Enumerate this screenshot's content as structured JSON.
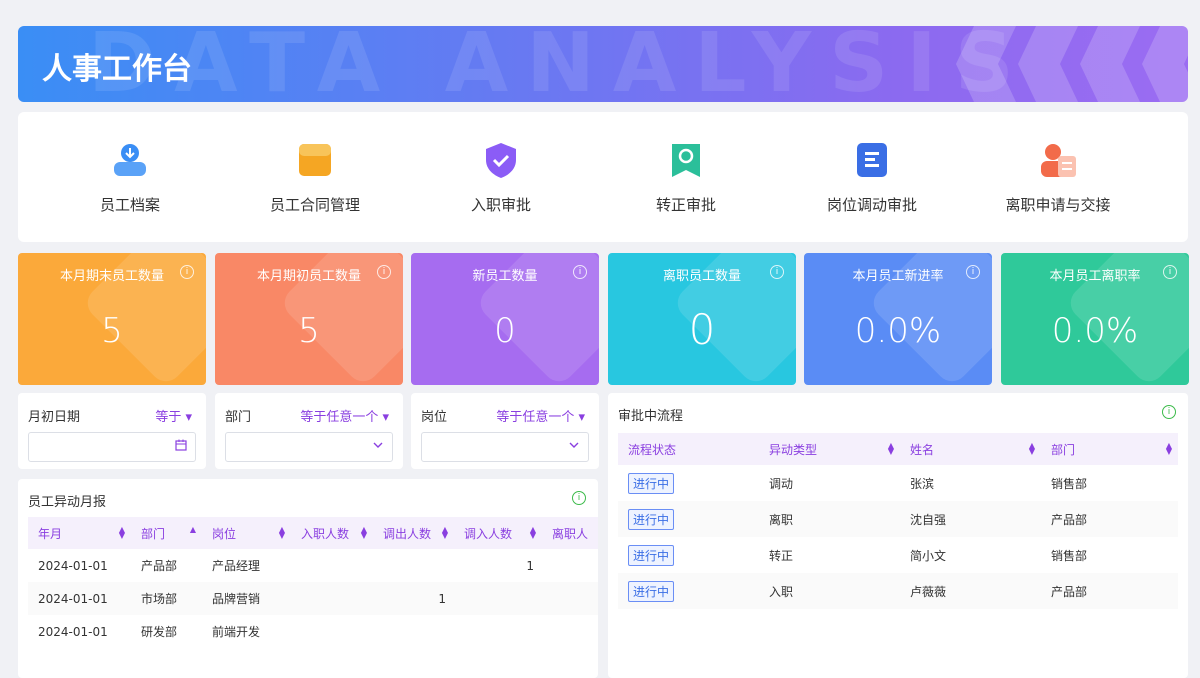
{
  "banner": {
    "title": "人事工作台",
    "bg_text": "DATA ANALYSIS"
  },
  "quick_actions": [
    {
      "label": "员工档案",
      "icon": "employee-file-icon",
      "color": "#3a8ef5"
    },
    {
      "label": "员工合同管理",
      "icon": "contract-icon",
      "color": "#f5a623"
    },
    {
      "label": "入职审批",
      "icon": "onboarding-shield-icon",
      "color": "#8b5cf6"
    },
    {
      "label": "转正审批",
      "icon": "regularization-icon",
      "color": "#2bbf9a"
    },
    {
      "label": "岗位调动审批",
      "icon": "transfer-doc-icon",
      "color": "#3a6ee5"
    },
    {
      "label": "离职申请与交接",
      "icon": "resignation-icon",
      "color": "#f26b4a"
    }
  ],
  "stats": [
    {
      "label": "本月期末员工数量",
      "value": "5",
      "color": "#fba93a"
    },
    {
      "label": "本月期初员工数量",
      "value": "5",
      "color": "#f98866"
    },
    {
      "label": "新员工数量",
      "value": "0",
      "color": "#a66cf0"
    },
    {
      "label": "离职员工数量",
      "value": "0",
      "color": "#28c7e0"
    },
    {
      "label": "本月员工新进率",
      "value": "0.0%",
      "color": "#5a8cf5"
    },
    {
      "label": "本月员工离职率",
      "value": "0.0%",
      "color": "#2fc99a"
    }
  ],
  "info_glyph": "i",
  "filters": [
    {
      "label": "月初日期",
      "op": "等于 ▾",
      "icon": "calendar-icon"
    },
    {
      "label": "部门",
      "op": "等于任意一个 ▾",
      "icon": "chevron-down-icon"
    },
    {
      "label": "岗位",
      "op": "等于任意一个 ▾",
      "icon": "chevron-down-icon"
    }
  ],
  "monthly_report": {
    "title": "员工异动月报",
    "columns": [
      "年月",
      "部门",
      "岗位",
      "入职人数",
      "调出人数",
      "调入人数",
      "离职人"
    ],
    "rows": [
      [
        "2024-01-01",
        "产品部",
        "产品经理",
        "",
        "",
        "1",
        ""
      ],
      [
        "2024-01-01",
        "市场部",
        "品牌营销",
        "",
        "1",
        "",
        ""
      ],
      [
        "2024-01-01",
        "研发部",
        "前端开发",
        "",
        "",
        "",
        ""
      ]
    ]
  },
  "approval_flow": {
    "title": "审批中流程",
    "columns": [
      "流程状态",
      "异动类型",
      "姓名",
      "部门"
    ],
    "rows": [
      [
        "进行中",
        "调动",
        "张滨",
        "销售部"
      ],
      [
        "进行中",
        "离职",
        "沈自强",
        "产品部"
      ],
      [
        "进行中",
        "转正",
        "简小文",
        "销售部"
      ],
      [
        "进行中",
        "入职",
        "卢薇薇",
        "产品部"
      ]
    ]
  }
}
